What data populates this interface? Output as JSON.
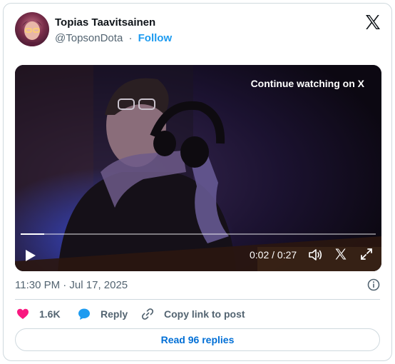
{
  "author": {
    "name": "Topias Taavitsainen",
    "handle": "@TopsonDota",
    "separator": "·",
    "follow_label": "Follow"
  },
  "video": {
    "cta_label": "Continue watching on X",
    "time_label": "0:02 / 0:27",
    "progress_fraction": 0.067
  },
  "timestamp": "11:30 PM · Jul 17, 2025",
  "actions": {
    "likes": "1.6K",
    "reply": "Reply",
    "copy_link": "Copy link to post"
  },
  "read_replies_label": "Read 96 replies",
  "colors": {
    "like": "#f91880",
    "reply": "#1d9bf0",
    "follow": "#1d9bf0",
    "read_replies": "#006fd6",
    "secondary_text": "#536471",
    "border": "#cfd9de"
  },
  "icons": [
    "x-logo-icon",
    "play-icon",
    "volume-icon",
    "x-icon",
    "fullscreen-icon",
    "info-icon",
    "heart-icon",
    "reply-bubble-icon",
    "link-icon"
  ]
}
